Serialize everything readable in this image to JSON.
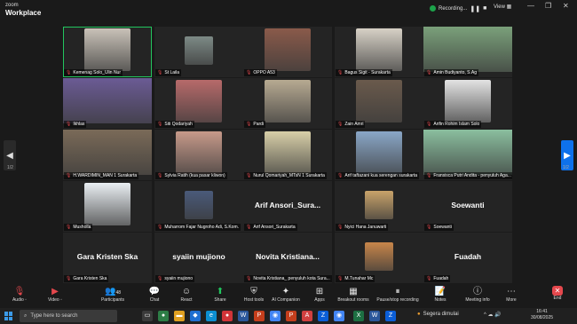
{
  "app": {
    "brand_top": "zoom",
    "brand_bottom": "Workplace"
  },
  "recording": {
    "label": "Recording...",
    "pause_icon": "pause-icon",
    "stop_icon": "stop-icon"
  },
  "view_label": "View",
  "pager": {
    "left": "1/2",
    "right": "1/2"
  },
  "tiles": [
    {
      "name": "Kemenag Solo_Ulin Nur",
      "kind": "video",
      "active": true,
      "color": "#c9c2b8",
      "video": "mid"
    },
    {
      "name": "St Laila",
      "kind": "video",
      "color": "#7d8a86",
      "video": "small"
    },
    {
      "name": "OPPO A53",
      "kind": "video",
      "color": "#8a5a4a",
      "video": "mid"
    },
    {
      "name": "Bagus Sigit - Surakarta",
      "kind": "video",
      "color": "#d7d1c6",
      "video": "mid"
    },
    {
      "name": "Amin Budiyanto, S.Ag",
      "kind": "video",
      "color": "#7aa07a",
      "video": "full"
    },
    {
      "name": "Ikhlas",
      "kind": "video",
      "color": "#6b5b95",
      "video": "full"
    },
    {
      "name": "Siti Qodariyah",
      "kind": "video",
      "color": "#b76a6a",
      "video": "mid"
    },
    {
      "name": "Pardi",
      "kind": "video",
      "color": "#b7aa92",
      "video": "mid"
    },
    {
      "name": "Zain Amri",
      "kind": "video",
      "color": "#6a5a4c",
      "video": "mid"
    },
    {
      "name": "Arifin Rohim Islam Solo",
      "kind": "video",
      "color": "#e3e3e3",
      "video": "mid"
    },
    {
      "name": "H.WARDIMIN_MAN 1 Surakarta",
      "kind": "video",
      "color": "#7a6a58",
      "video": "full"
    },
    {
      "name": "Sylvia Ratih (kua pasar kliwon)",
      "kind": "video",
      "color": "#c79a8a",
      "video": "mid"
    },
    {
      "name": "Nurul Qomariyah_MTsN 1 Surakarta",
      "kind": "video",
      "color": "#d8cfa8",
      "video": "mid"
    },
    {
      "name": "Arif taftazani kua serengan surakarta",
      "kind": "video",
      "color": "#8aa7c7",
      "video": "mid"
    },
    {
      "name": "Fransisca Putri Andita - penyuluh Aga...",
      "kind": "video",
      "color": "#8bbf9f",
      "video": "full"
    },
    {
      "name": "Musholla",
      "kind": "video",
      "color": "#e9eef2",
      "video": "mid"
    },
    {
      "name": "Muharrom Fajar Nugroho Adi, S.Kom.",
      "kind": "video",
      "color": "#4a5a7a",
      "video": "small"
    },
    {
      "name": "Arif Ansori_Surakarta",
      "kind": "name",
      "big": "Arif  Ansori_Sura..."
    },
    {
      "name": "Nyici Hana Januwarti",
      "kind": "video",
      "color": "#c9a36a",
      "video": "small"
    },
    {
      "name": "Soewanti",
      "kind": "name",
      "big": "Soewanti"
    },
    {
      "name": "Gara Kristen Ska",
      "kind": "name",
      "big": "Gara Kristen Ska"
    },
    {
      "name": "syaiin mujiono",
      "kind": "name",
      "big": "syaiin mujiono"
    },
    {
      "name": "Novita Kristiana_ penyuluh kota Sura...",
      "kind": "name",
      "big": "Novita  Kristiana..."
    },
    {
      "name": "M.Tunahar Mc",
      "kind": "video",
      "color": "#c8864a",
      "video": "small"
    },
    {
      "name": "Fuadah",
      "kind": "name",
      "big": "Fuadah"
    }
  ],
  "toolbar": {
    "audio": "Audio",
    "video": "Video",
    "participants": "Participants",
    "participants_count": "48",
    "chat": "Chat",
    "react": "React",
    "share": "Share",
    "host_tools": "Host tools",
    "ai": "AI Companion",
    "apps": "Apps",
    "breakout": "Breakout rooms",
    "record": "Pause/stop recording",
    "notes": "Notes",
    "meeting_info": "Meeting info",
    "more": "More",
    "end": "End"
  },
  "taskbar": {
    "search_placeholder": "Type here to search",
    "weather": "Segera dimulai",
    "time": "16:41",
    "date": "30/08/2025"
  }
}
